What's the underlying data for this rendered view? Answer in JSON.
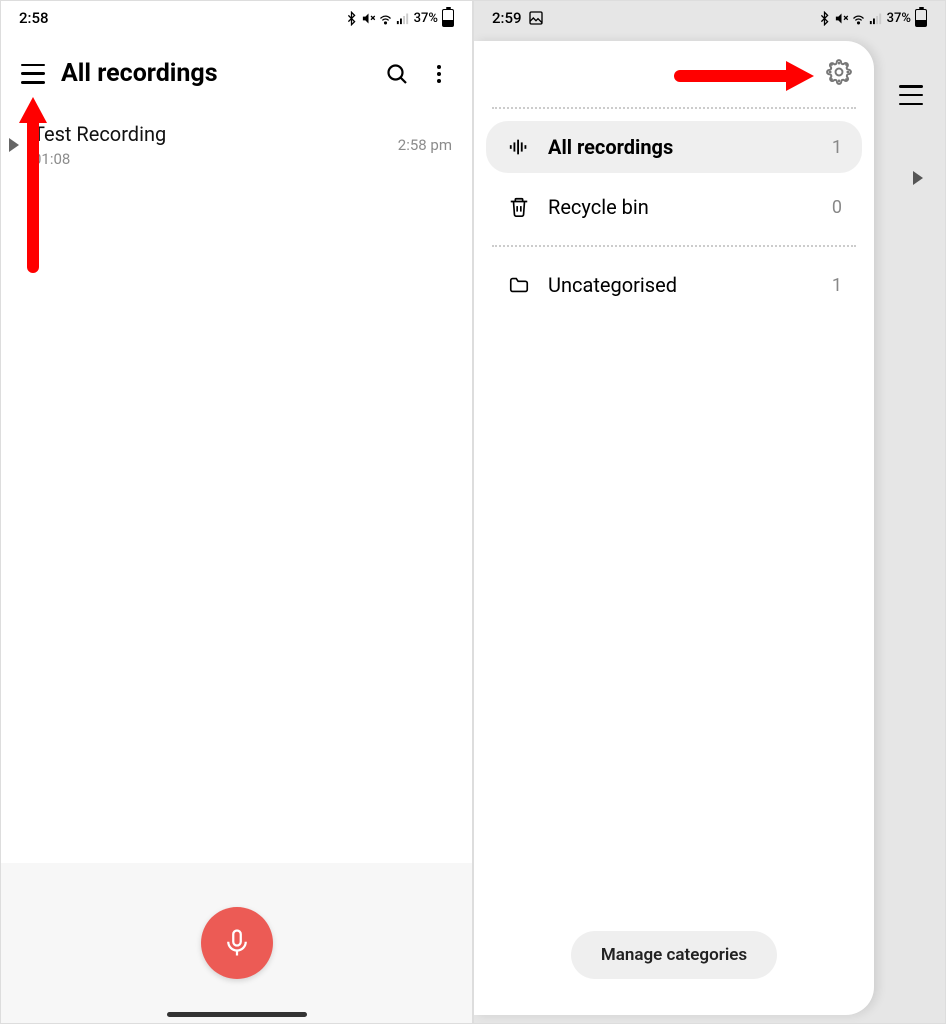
{
  "phone1": {
    "status": {
      "time": "2:58",
      "battery_pct": "37%"
    },
    "header": {
      "title": "All recordings"
    },
    "recording": {
      "title": "Test Recording",
      "duration": "01:08",
      "time": "2:58 pm"
    }
  },
  "phone2": {
    "status": {
      "time": "2:59",
      "battery_pct": "37%"
    },
    "drawer": {
      "items": [
        {
          "label": "All recordings",
          "count": "1"
        },
        {
          "label": "Recycle bin",
          "count": "0"
        },
        {
          "label": "Uncategorised",
          "count": "1"
        }
      ],
      "manage_label": "Manage categories"
    }
  }
}
